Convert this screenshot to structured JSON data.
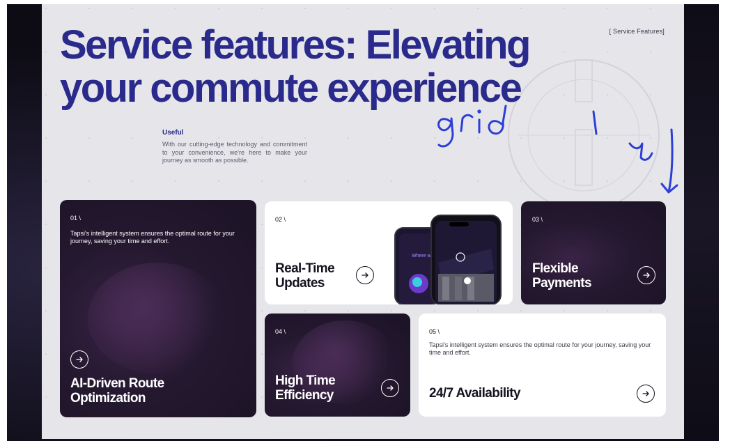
{
  "slide": {
    "headline_line1": "Service features: Elevating",
    "headline_line2": "your commute experience",
    "section_tag": "[ Service Features]",
    "useful": {
      "title": "Useful",
      "text": "With our cutting-edge technology and commitment to your convenience, we're here to make your journey as smooth as possible."
    }
  },
  "annotation": {
    "text": "grid 1 by"
  },
  "cards": [
    {
      "number": "01 \\",
      "description": "Tapsi's intelligent system ensures the optimal route for your journey, saving your time and effort.",
      "title_line1": "AI-Driven Route",
      "title_line2": "Optimization",
      "theme": "dark"
    },
    {
      "number": "02 \\",
      "title_line1": "Real-Time",
      "title_line2": "Updates",
      "theme": "light",
      "phone_text": "Where wo want to"
    },
    {
      "number": "03 \\",
      "title_line1": "Flexible",
      "title_line2": "Payments",
      "theme": "dark"
    },
    {
      "number": "04 \\",
      "title_line1": "High Time",
      "title_line2": "Efficiency",
      "theme": "dark"
    },
    {
      "number": "05 \\",
      "description": "Tapsi's intelligent system ensures the optimal route for your journey, saving your time and effort.",
      "title": "24/7 Availability",
      "theme": "light"
    }
  ],
  "icons": {
    "card_action": "arrow-right-icon"
  },
  "colors": {
    "headline": "#2a2a8c",
    "slide_background": "#e6e6ea",
    "dark_card": "#24182f",
    "light_card": "#ffffff",
    "annotation_ink": "#2b3fd6"
  }
}
